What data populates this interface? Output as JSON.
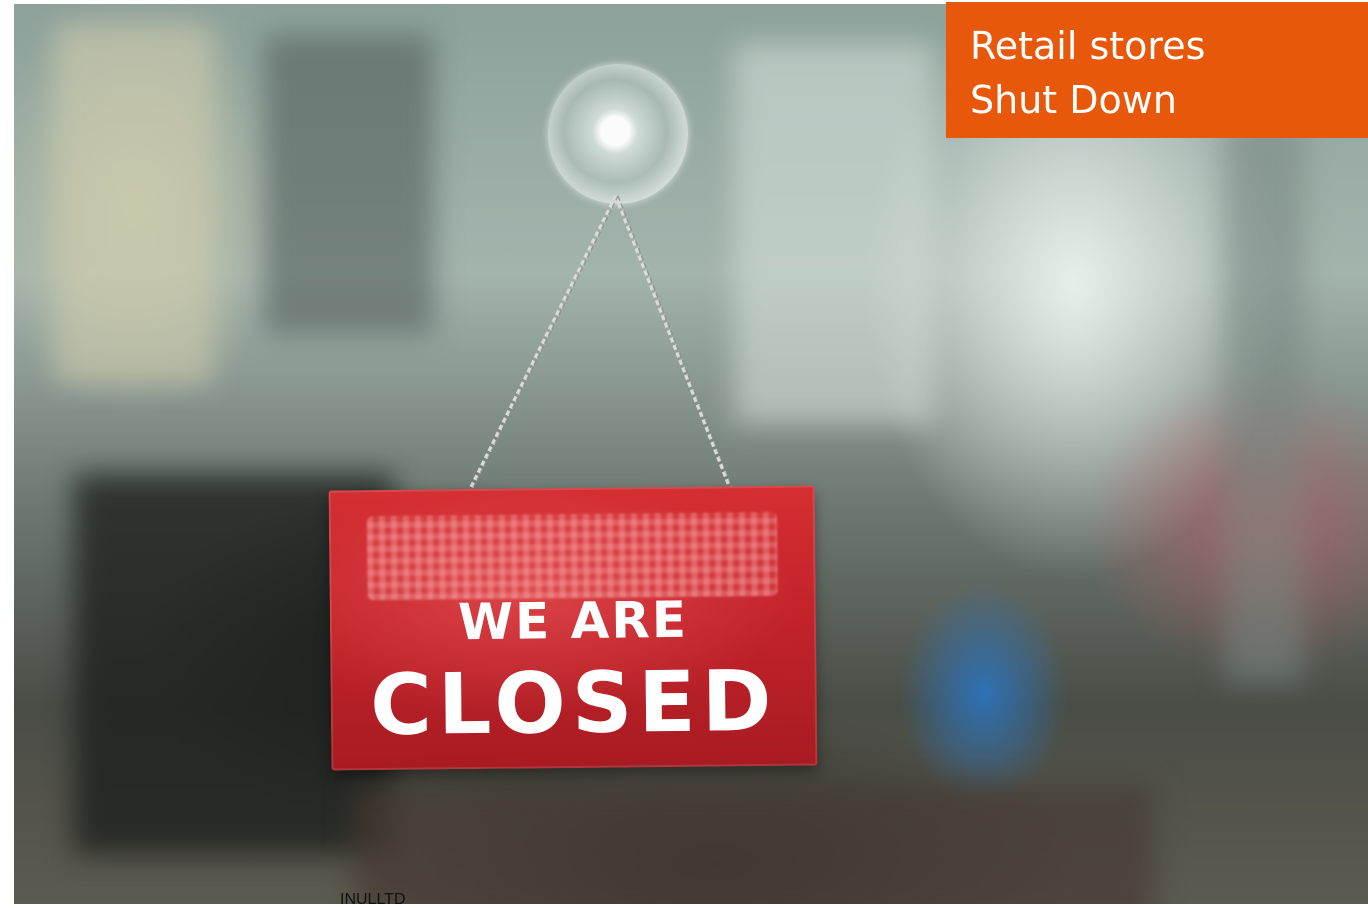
{
  "headline": {
    "line1": "Retail stores",
    "line2": "Shut Down",
    "background": "#e8580b"
  },
  "sign": {
    "line1": "WE ARE",
    "line2": "CLOSED",
    "color": "#c4232a"
  },
  "credit": "INULLTD"
}
